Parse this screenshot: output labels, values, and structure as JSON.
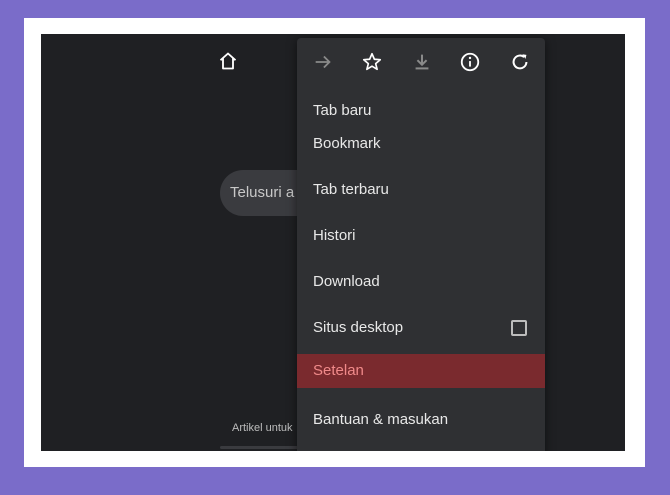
{
  "search": {
    "text": "Telusuri a"
  },
  "footer": {
    "text": "Artikel untuk"
  },
  "toolbar": {
    "icons": [
      "forward-icon",
      "star-icon",
      "download-icon",
      "info-icon",
      "refresh-icon"
    ]
  },
  "menu": {
    "items": [
      {
        "label": "Tab baru"
      },
      {
        "label": "Bookmark"
      },
      {
        "label": "Tab terbaru"
      },
      {
        "label": "Histori"
      },
      {
        "label": "Download"
      },
      {
        "label": "Situs desktop"
      },
      {
        "label": "Setelan"
      },
      {
        "label": "Bantuan & masukan"
      }
    ]
  },
  "colors": {
    "background": "#7a6cc9",
    "screen": "#1f2023",
    "menu": "#2f3033",
    "highlight": "#7a2a2e",
    "highlight_text": "#f08a8a"
  }
}
